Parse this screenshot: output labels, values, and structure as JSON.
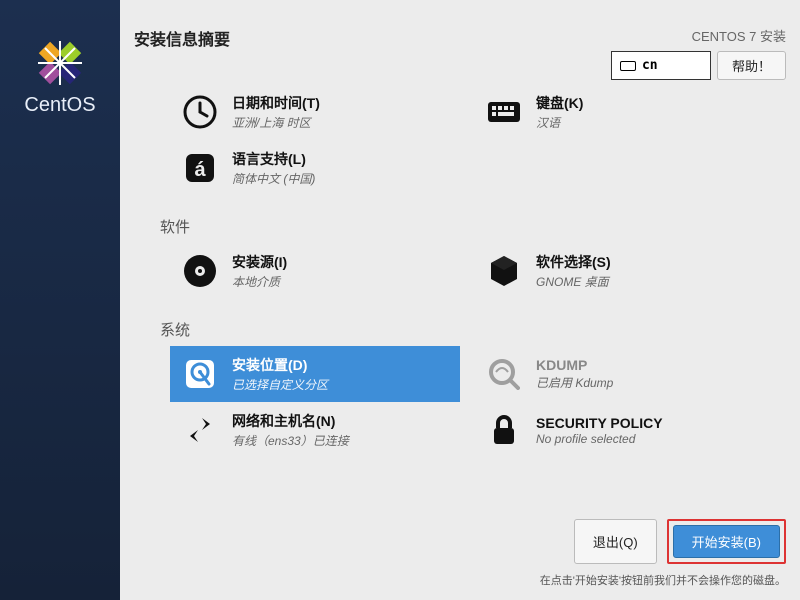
{
  "brand": "CentOS",
  "header": {
    "title": "安装信息摘要",
    "product": "CENTOS 7 安装",
    "lang_code": "cn",
    "help": "帮助！"
  },
  "sections": {
    "software": "软件",
    "system": "系统"
  },
  "spokes": {
    "datetime": {
      "title": "日期和时间(T)",
      "subtitle": "亚洲/上海 时区"
    },
    "keyboard": {
      "title": "键盘(K)",
      "subtitle": "汉语"
    },
    "langsupport": {
      "title": "语言支持(L)",
      "subtitle": "简体中文 (中国)"
    },
    "source": {
      "title": "安装源(I)",
      "subtitle": "本地介质"
    },
    "software": {
      "title": "软件选择(S)",
      "subtitle": "GNOME 桌面"
    },
    "dest": {
      "title": "安装位置(D)",
      "subtitle": "已选择自定义分区"
    },
    "kdump": {
      "title": "KDUMP",
      "subtitle": "已启用 Kdump"
    },
    "network": {
      "title": "网络和主机名(N)",
      "subtitle": "有线（ens33）已连接"
    },
    "security": {
      "title": "SECURITY POLICY",
      "subtitle": "No profile selected"
    }
  },
  "footer": {
    "quit": "退出(Q)",
    "begin": "开始安装(B)",
    "hint": "在点击'开始安装'按钮前我们并不会操作您的磁盘。"
  }
}
